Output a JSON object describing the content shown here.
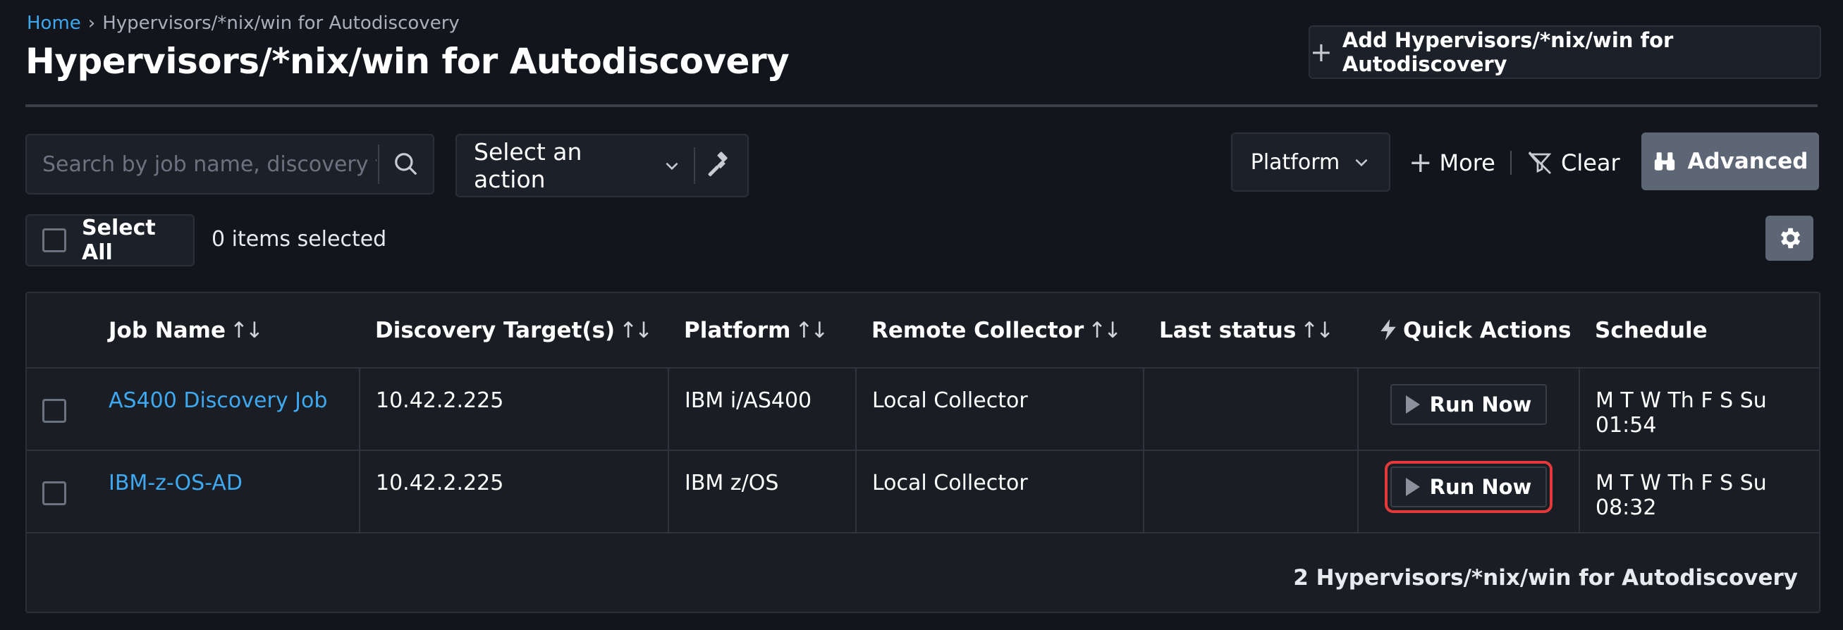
{
  "breadcrumb": {
    "home": "Home",
    "separator": "›",
    "current": "Hypervisors/*nix/win for Autodiscovery"
  },
  "page": {
    "title": "Hypervisors/*nix/win for Autodiscovery",
    "add_button_label": "Add Hypervisors/*nix/win for Autodiscovery"
  },
  "toolbar": {
    "search_placeholder": "Search by job name, discovery target",
    "action_select_label": "Select an action",
    "platform_label": "Platform",
    "more_label": "More",
    "clear_label": "Clear",
    "advanced_label": "Advanced"
  },
  "selection": {
    "select_all_label": "Select All",
    "items_selected": "0 items selected"
  },
  "table": {
    "columns": {
      "job_name": "Job Name",
      "targets": "Discovery Target(s)",
      "platform": "Platform",
      "collector": "Remote Collector",
      "last_status": "Last status",
      "quick_actions": "Quick Actions",
      "schedule": "Schedule"
    },
    "sort_glyph": "↑↓",
    "rows": [
      {
        "job_name": "AS400 Discovery Job",
        "targets": "10.42.2.225",
        "platform": "IBM i/AS400",
        "collector": "Local Collector",
        "last_status": "",
        "action": "Run Now",
        "schedule": "M T W Th F S Su 01:54"
      },
      {
        "job_name": "IBM-z-OS-AD",
        "targets": "10.42.2.225",
        "platform": "IBM z/OS",
        "collector": "Local Collector",
        "last_status": "",
        "action": "Run Now",
        "schedule": "M T W Th F S Su 08:32"
      }
    ],
    "footer_count": "2 Hypervisors/*nix/win for Autodiscovery"
  },
  "colors": {
    "background": "#12151b",
    "link": "#3ea8f0",
    "accent_gray": "#5d6675",
    "highlight": "#e23a3a"
  },
  "icons": [
    "plus-icon",
    "search-icon",
    "chevron-down-icon",
    "gavel-icon",
    "filter-clear-icon",
    "binoculars-icon",
    "gear-icon",
    "lightning-icon",
    "play-icon"
  ]
}
